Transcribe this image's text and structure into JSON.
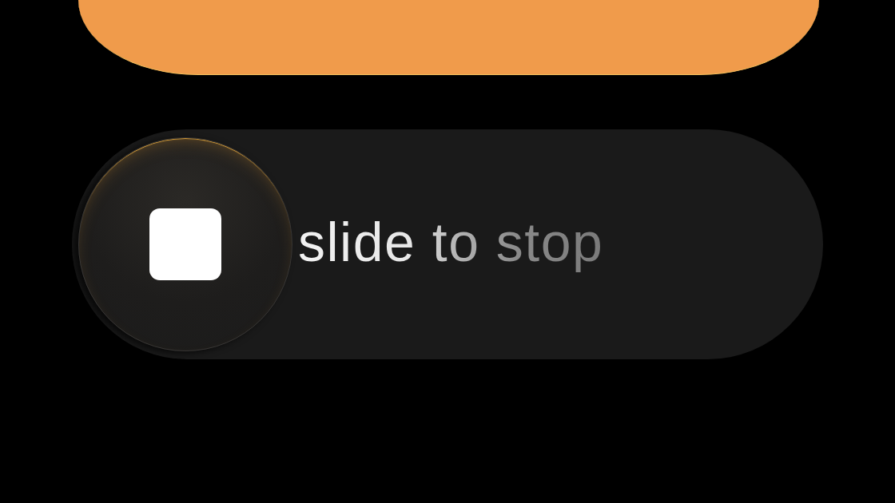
{
  "slider": {
    "label": "slide to stop",
    "level": 0
  }
}
